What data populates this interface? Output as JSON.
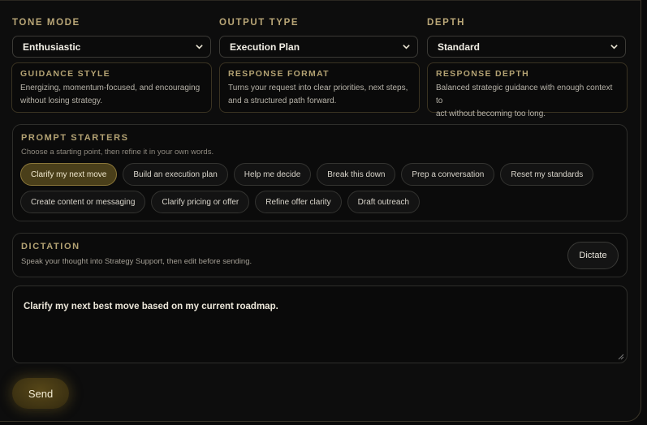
{
  "selects": {
    "tone": {
      "label": "TONE MODE",
      "value": "Enthusiastic"
    },
    "output": {
      "label": "OUTPUT TYPE",
      "value": "Execution Plan"
    },
    "depth": {
      "label": "DEPTH",
      "value": "Standard"
    }
  },
  "cards": {
    "guidance": {
      "title": "GUIDANCE STYLE",
      "text1": "Energizing, momentum-focused, and encouraging",
      "text2": "without losing strategy."
    },
    "format": {
      "title": "RESPONSE FORMAT",
      "text1": "Turns your request into clear priorities, next steps,",
      "text2": "and a structured path forward."
    },
    "depth": {
      "title": "RESPONSE DEPTH",
      "text1": "Balanced strategic guidance with enough context to",
      "text2": "act without becoming too long."
    }
  },
  "starters": {
    "title": "PROMPT STARTERS",
    "subtitle": "Choose a starting point, then refine it in your own words.",
    "row1": [
      "Clarify my next move",
      "Build an execution plan",
      "Help me decide",
      "Break this down",
      "Prep a conversation",
      "Reset my standards"
    ],
    "row2": [
      "Create content or messaging",
      "Clarify pricing or offer",
      "Refine offer clarity",
      "Draft outreach"
    ]
  },
  "dictation": {
    "title": "DICTATION",
    "subtitle": "Speak your thought into Strategy Support, then edit before sending.",
    "button": "Dictate"
  },
  "message": {
    "text": "Clarify my next best move based on my current roadmap."
  },
  "send": {
    "label": "Send"
  },
  "colors": {
    "accent": "#b3a273",
    "active_chip": "#4a3f1a",
    "send_glow": "#574718"
  }
}
